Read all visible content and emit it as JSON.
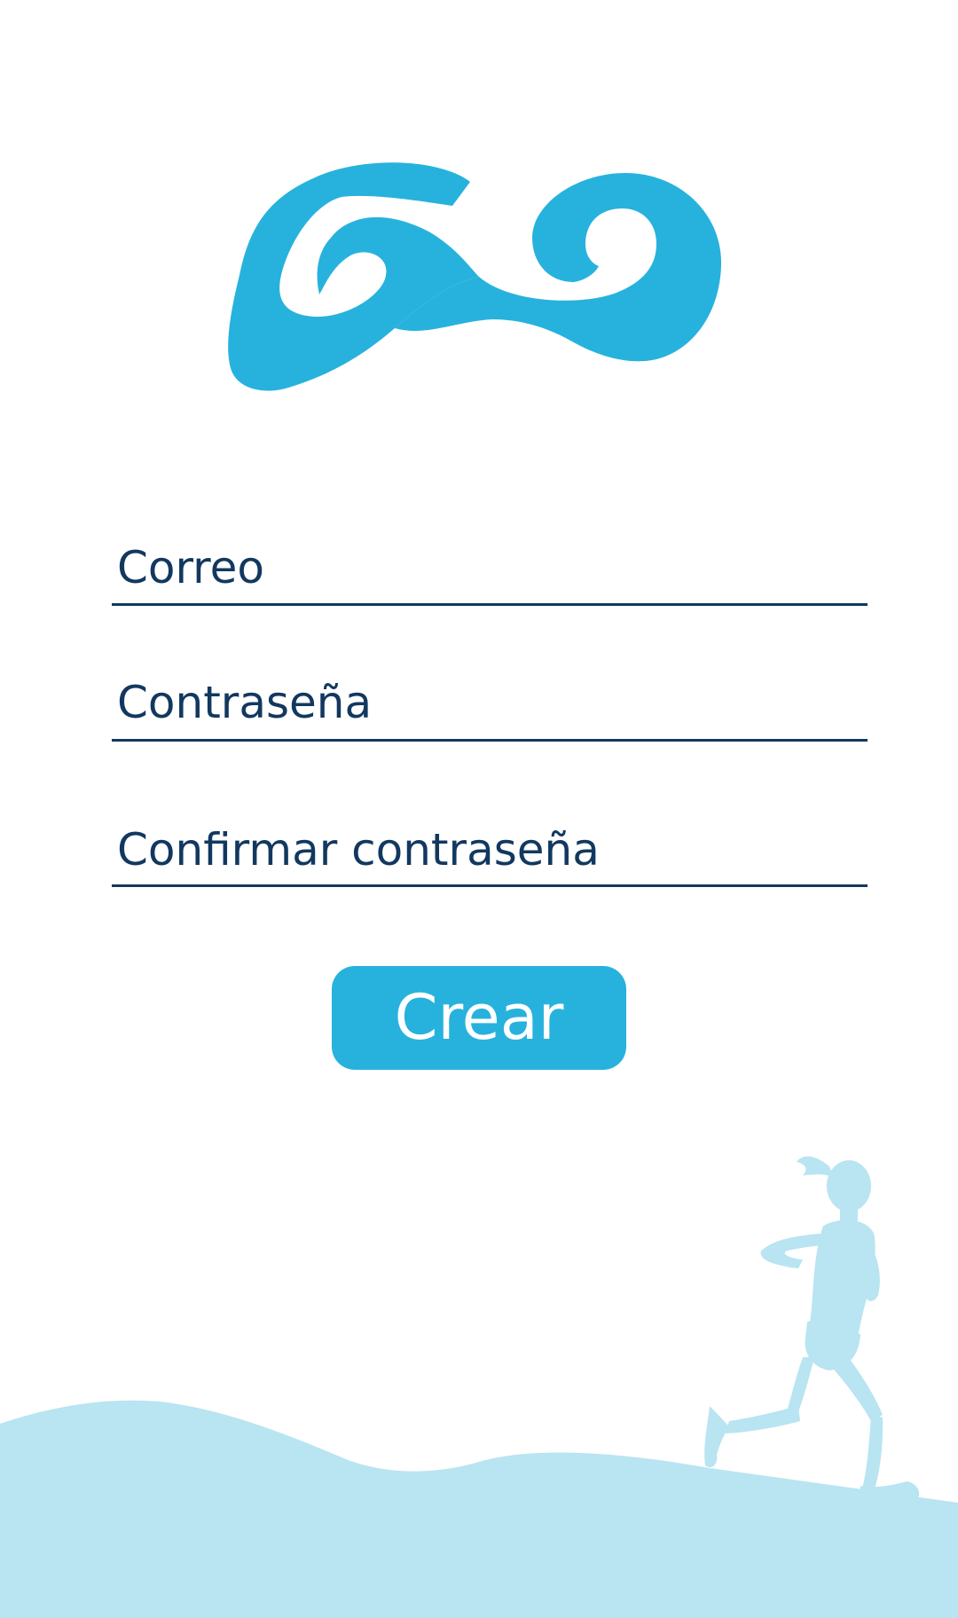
{
  "form": {
    "email_placeholder": "Correo",
    "password_placeholder": "Contraseña",
    "confirm_password_placeholder": "Confirmar contraseña",
    "submit_label": "Crear"
  },
  "colors": {
    "brand": "#27b2dd",
    "text": "#12385f",
    "background": "#ffffff",
    "scenery": "#b9e4f2",
    "runner": "#b9e4f2"
  },
  "icons": {
    "logo": "go-logo-icon",
    "illustration": "runner-silhouette-icon"
  }
}
